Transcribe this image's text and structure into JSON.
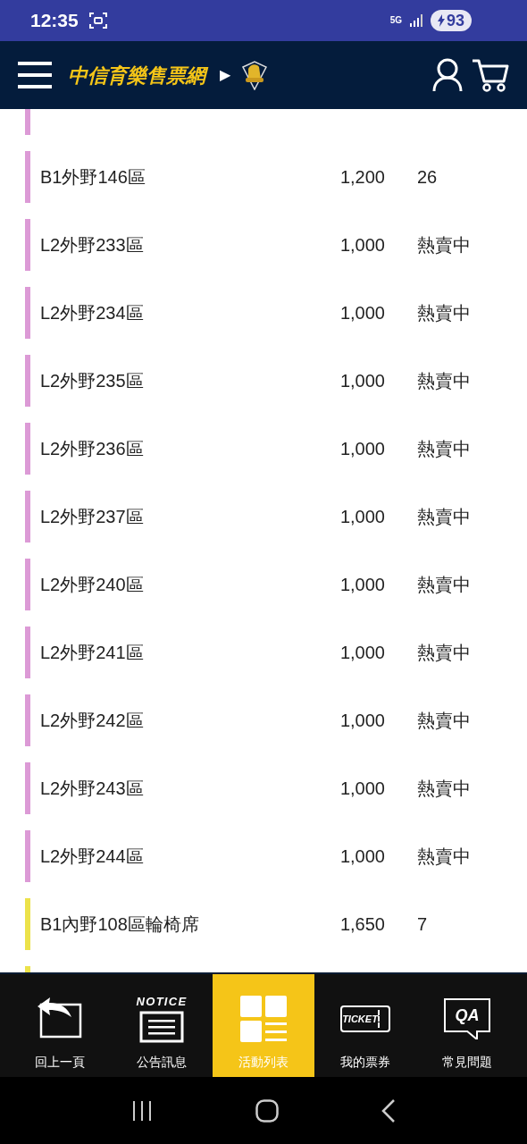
{
  "status_bar": {
    "time": "12:35",
    "network": "5G",
    "battery": "93"
  },
  "header": {
    "title": "中信育樂售票網",
    "separator": "▶"
  },
  "rows": [
    {
      "color": "#dc9ad6"
    },
    {
      "name": "B1外野146區",
      "price": "1,200",
      "status": "26",
      "color": "#dc9ad6"
    },
    {
      "name": "L2外野233區",
      "price": "1,000",
      "status": "熱賣中",
      "color": "#dc9ad6"
    },
    {
      "name": "L2外野234區",
      "price": "1,000",
      "status": "熱賣中",
      "color": "#dc9ad6"
    },
    {
      "name": "L2外野235區",
      "price": "1,000",
      "status": "熱賣中",
      "color": "#dc9ad6"
    },
    {
      "name": "L2外野236區",
      "price": "1,000",
      "status": "熱賣中",
      "color": "#dc9ad6"
    },
    {
      "name": "L2外野237區",
      "price": "1,000",
      "status": "熱賣中",
      "color": "#dc9ad6"
    },
    {
      "name": "L2外野240區",
      "price": "1,000",
      "status": "熱賣中",
      "color": "#dc9ad6"
    },
    {
      "name": "L2外野241區",
      "price": "1,000",
      "status": "熱賣中",
      "color": "#dc9ad6"
    },
    {
      "name": "L2外野242區",
      "price": "1,000",
      "status": "熱賣中",
      "color": "#dc9ad6"
    },
    {
      "name": "L2外野243區",
      "price": "1,000",
      "status": "熱賣中",
      "color": "#dc9ad6"
    },
    {
      "name": "L2外野244區",
      "price": "1,000",
      "status": "熱賣中",
      "color": "#dc9ad6"
    },
    {
      "name": "B1內野108區輪椅席",
      "price": "1,650",
      "status": "7",
      "color": "#ece24a"
    },
    {
      "color": "#ece24a"
    }
  ],
  "bottom_nav": [
    {
      "kind": "back",
      "label": "回上一頁",
      "selected": false
    },
    {
      "kind": "notice",
      "label": "公告訊息",
      "icon_text": "NOTICE",
      "selected": false
    },
    {
      "kind": "list",
      "label": "活動列表",
      "selected": true
    },
    {
      "kind": "ticket",
      "label": "我的票券",
      "icon_text": "TICKET",
      "selected": false
    },
    {
      "kind": "qa",
      "label": "常見問題",
      "icon_text": "QA",
      "selected": false
    }
  ]
}
